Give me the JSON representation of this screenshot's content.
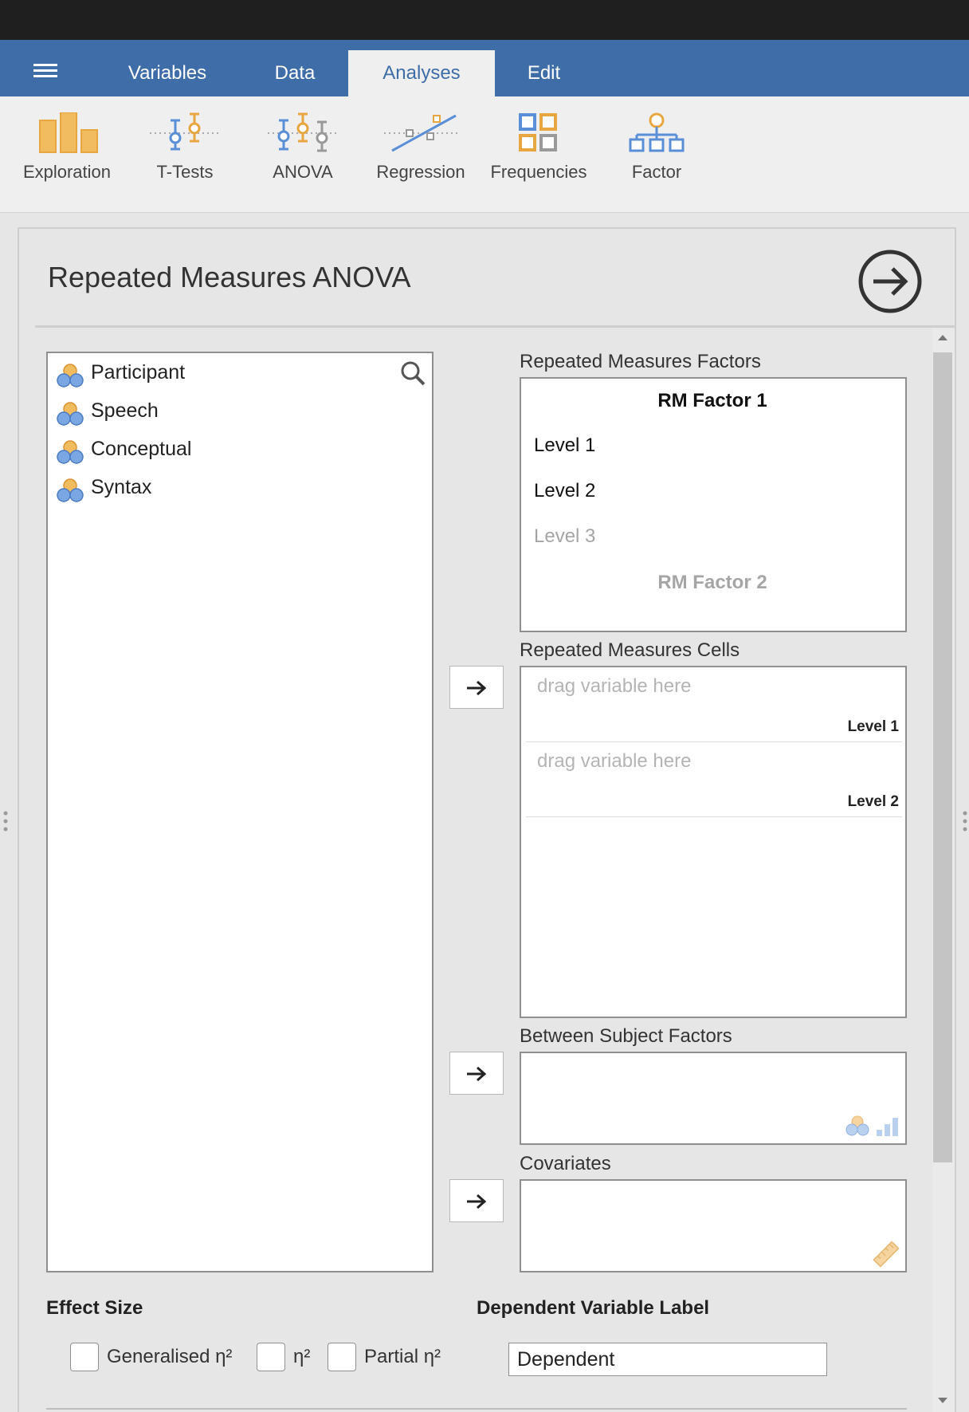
{
  "menubar": {
    "tabs": [
      {
        "label": "Variables",
        "active": false
      },
      {
        "label": "Data",
        "active": false
      },
      {
        "label": "Analyses",
        "active": true
      },
      {
        "label": "Edit",
        "active": false
      }
    ]
  },
  "ribbon": {
    "items": [
      {
        "label": "Exploration",
        "icon": "bar-chart-icon"
      },
      {
        "label": "T-Tests",
        "icon": "ttest-icon"
      },
      {
        "label": "ANOVA",
        "icon": "anova-icon"
      },
      {
        "label": "Regression",
        "icon": "regression-icon"
      },
      {
        "label": "Frequencies",
        "icon": "frequencies-icon"
      },
      {
        "label": "Factor",
        "icon": "factor-icon"
      }
    ]
  },
  "panel": {
    "title": "Repeated Measures ANOVA"
  },
  "variables": [
    {
      "name": "Participant"
    },
    {
      "name": "Speech"
    },
    {
      "name": "Conceptual"
    },
    {
      "name": "Syntax"
    }
  ],
  "rm_factors": {
    "label": "Repeated Measures Factors",
    "factor1": "RM Factor 1",
    "levels": [
      "Level 1",
      "Level 2",
      "Level 3"
    ],
    "factor2": "RM Factor 2"
  },
  "rm_cells": {
    "label": "Repeated Measures Cells",
    "cells": [
      {
        "placeholder": "drag variable here",
        "level": "Level 1"
      },
      {
        "placeholder": "drag variable here",
        "level": "Level 2"
      }
    ]
  },
  "between": {
    "label": "Between Subject Factors"
  },
  "covariates": {
    "label": "Covariates"
  },
  "effect_size": {
    "heading": "Effect Size",
    "options": [
      {
        "label": "Generalised η²",
        "checked": false
      },
      {
        "label": "η²",
        "checked": false
      },
      {
        "label": "Partial η²",
        "checked": false
      }
    ]
  },
  "dv_label": {
    "heading": "Dependent Variable Label",
    "value": "Dependent"
  },
  "colors": {
    "brand": "#3e6da8",
    "icon_orange": "#e8a640",
    "icon_blue": "#5a8fd8"
  }
}
